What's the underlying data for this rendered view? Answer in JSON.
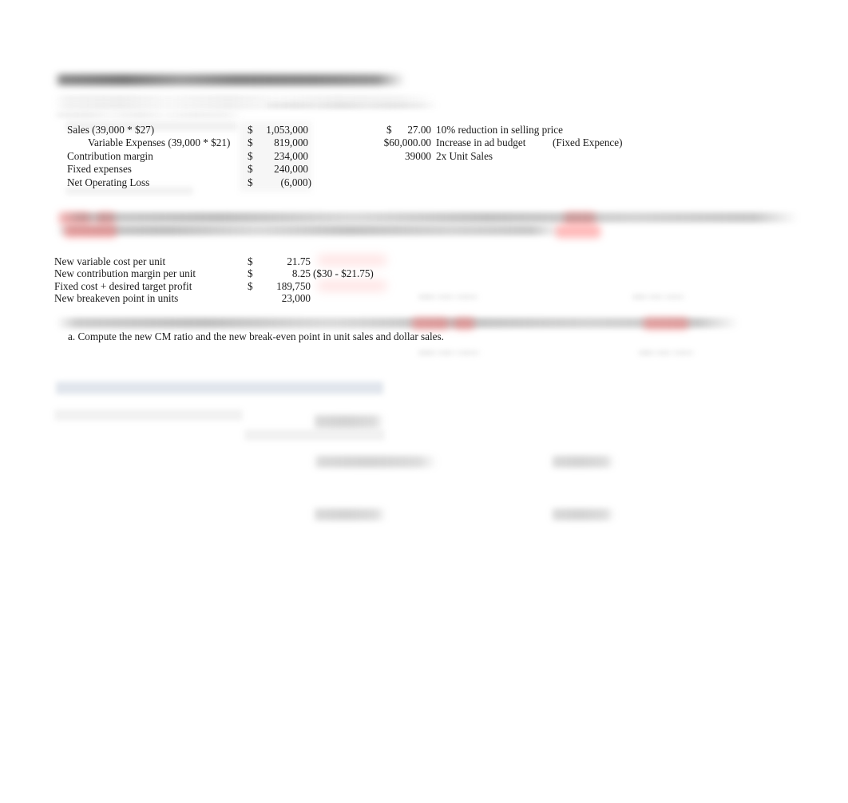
{
  "document": {
    "title_redacted": "",
    "page_background": "#ffffff",
    "text_color": "#1c1c1c",
    "highlight_pink": "#ff5555",
    "highlight_blue": "#e1e6ed"
  },
  "income_statement": {
    "rows": [
      {
        "label": "Sales (39,000 * $27)",
        "currency": "$",
        "amount": "1,053,000",
        "indent": 0
      },
      {
        "label": "Variable Expenses (39,000 * $21)",
        "currency": "$",
        "amount": "819,000",
        "indent": 1
      },
      {
        "label": "Contribution margin",
        "currency": "$",
        "amount": "234,000",
        "indent": 0
      },
      {
        "label": "Fixed expenses",
        "currency": "$",
        "amount": "240,000",
        "indent": 0
      },
      {
        "label": "Net Operating Loss",
        "currency": "$",
        "amount": "(6,000)",
        "indent": 0
      }
    ]
  },
  "assumptions": {
    "rows": [
      {
        "value": "$      27.00",
        "label": "10% reduction in selling price",
        "note": ""
      },
      {
        "value": "$60,000.00",
        "label": "Increase in ad budget",
        "note": "(Fixed Expence)"
      },
      {
        "value": "39000",
        "label": "2x Unit Sales",
        "note": ""
      }
    ]
  },
  "breakeven": {
    "rows": [
      {
        "label": "New variable cost per unit",
        "currency": "$",
        "amount": "21.75",
        "suffix": ""
      },
      {
        "label": "New contribution margin per unit",
        "currency": "$",
        "amount": "8.25",
        "suffix": "($30 - $21.75)"
      },
      {
        "label": "Fixed cost + desired target profit",
        "currency": "$",
        "amount": "189,750",
        "suffix": ""
      },
      {
        "label": "New breakeven point in units",
        "currency": "",
        "amount": "23,000",
        "suffix": ""
      }
    ]
  },
  "question": {
    "prompt_redacted": "",
    "part_a": "a. Compute the new CM ratio and the new break-even point in unit sales and dollar sales."
  }
}
